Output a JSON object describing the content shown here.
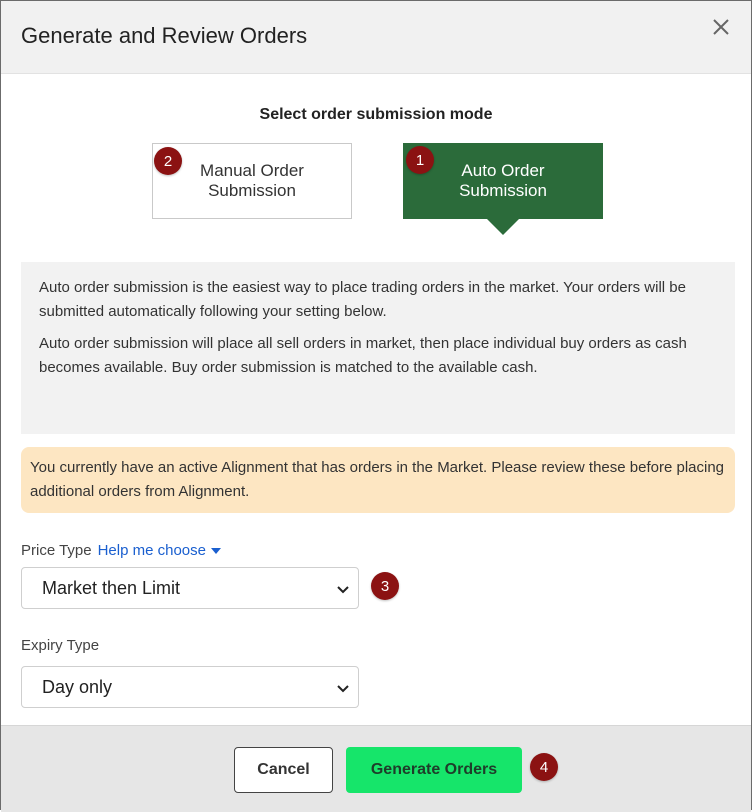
{
  "dialog": {
    "title": "Generate and Review Orders",
    "close_icon": "close-icon"
  },
  "mode": {
    "heading": "Select order submission mode",
    "manual": {
      "label": "Manual Order\nSubmission",
      "badge": "2",
      "selected": false
    },
    "auto": {
      "label": "Auto Order\nSubmission",
      "badge": "1",
      "selected": true
    }
  },
  "info": {
    "paragraph1": "Auto order submission is the easiest way to place trading orders in the market. Your orders will be submitted automatically following your setting below.",
    "paragraph2": "Auto order submission will place all sell orders in market, then place individual buy orders as cash becomes available.  Buy order submission is matched to the available cash."
  },
  "warning": {
    "text": "You currently have an active Alignment that has orders in the Market. Please review these before placing additional orders from Alignment."
  },
  "price_type": {
    "label": "Price Type",
    "help_link": "Help me choose",
    "value": "Market then Limit",
    "badge": "3"
  },
  "expiry_type": {
    "label": "Expiry Type",
    "value": "Day only"
  },
  "footer": {
    "cancel_label": "Cancel",
    "generate_label": "Generate Orders",
    "badge": "4"
  },
  "colors": {
    "auto_selected": "#2b6b3a",
    "generate_button": "#16e56a",
    "badge": "#8b1212",
    "link": "#1a5fcf",
    "warning_bg": "#fde6c2"
  }
}
